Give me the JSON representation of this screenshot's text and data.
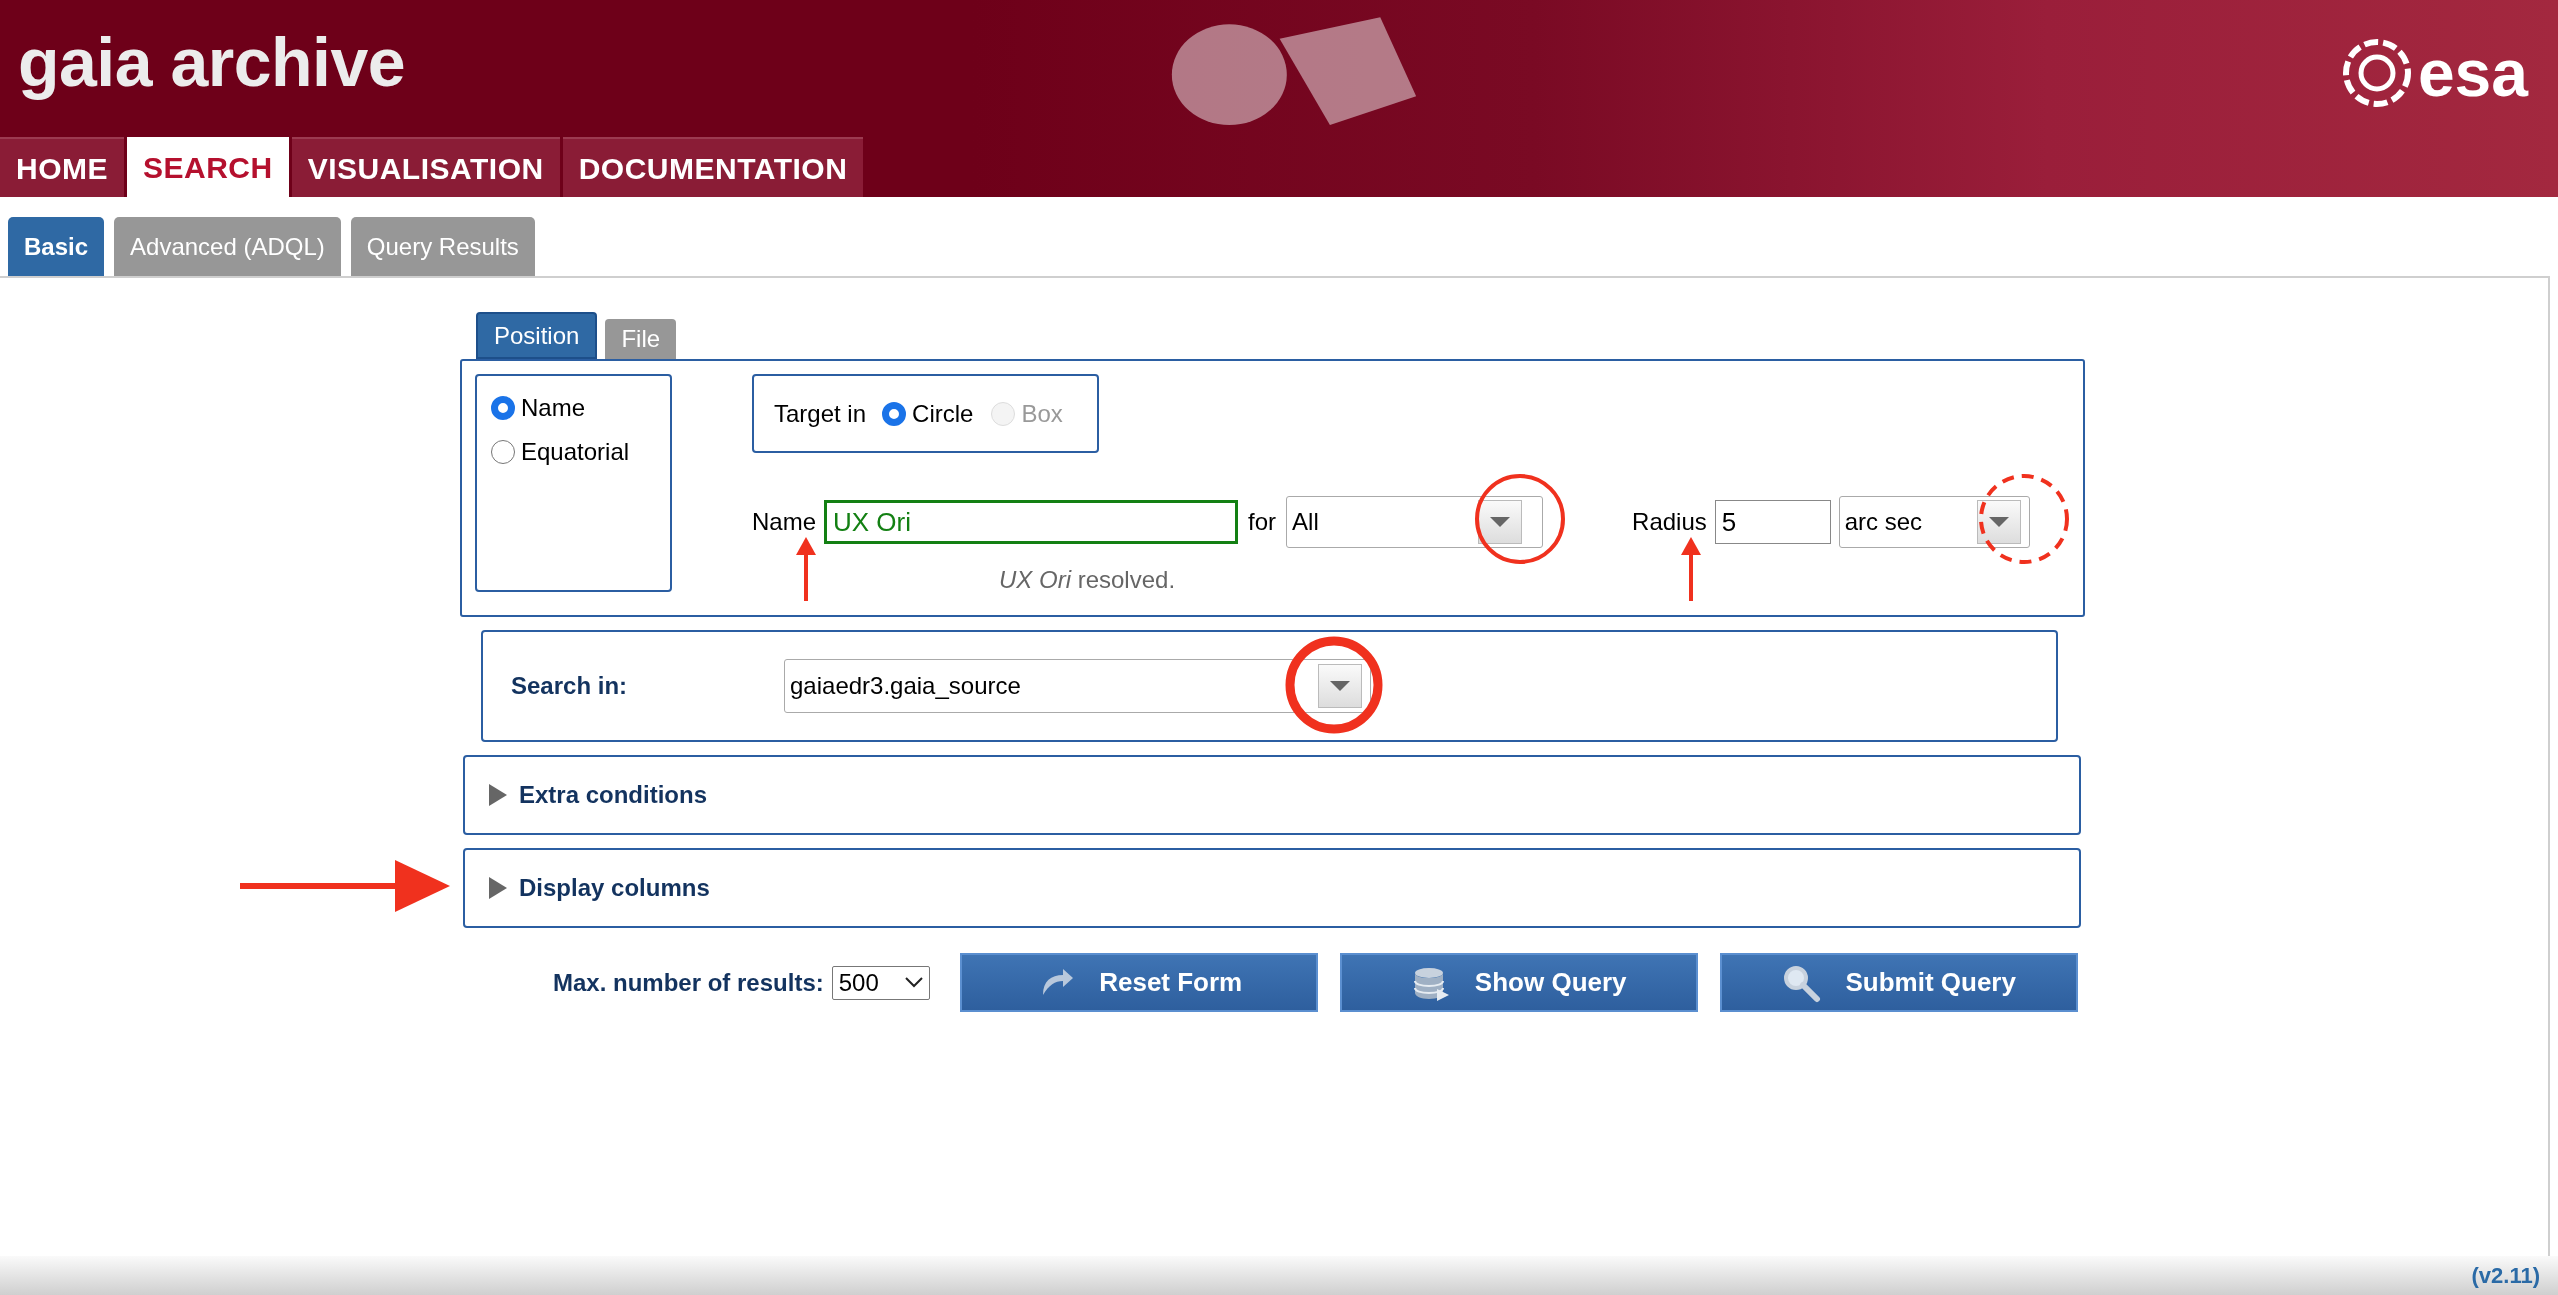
{
  "header": {
    "title": "gaia archive",
    "logo_text": "esa"
  },
  "nav": [
    {
      "label": "HOME",
      "selected": false
    },
    {
      "label": "SEARCH",
      "selected": true
    },
    {
      "label": "VISUALISATION",
      "selected": false
    },
    {
      "label": "DOCUMENTATION",
      "selected": false
    }
  ],
  "subtabs": [
    {
      "label": "Basic",
      "selected": true
    },
    {
      "label": "Advanced (ADQL)",
      "selected": false
    },
    {
      "label": "Query Results",
      "selected": false
    }
  ],
  "position_tabs": [
    {
      "label": "Position",
      "selected": true
    },
    {
      "label": "File",
      "selected": false
    }
  ],
  "target_type": [
    {
      "label": "Name",
      "selected": true
    },
    {
      "label": "Equatorial",
      "selected": false
    }
  ],
  "target_in": {
    "label": "Target in",
    "options": [
      {
        "label": "Circle",
        "selected": true,
        "disabled": false
      },
      {
        "label": "Box",
        "selected": false,
        "disabled": true
      }
    ]
  },
  "name_field": {
    "label": "Name",
    "value": "UX Ori",
    "status": "*UX Ori* resolved."
  },
  "for_field": {
    "label": "for",
    "value": "All"
  },
  "radius": {
    "label": "Radius",
    "value": "5",
    "unit": "arc sec"
  },
  "search_in": {
    "label": "Search in:",
    "value": "gaiaedr3.gaia_source"
  },
  "sections": [
    {
      "label": "Extra conditions",
      "expanded": false
    },
    {
      "label": "Display columns",
      "expanded": false
    }
  ],
  "max_results": {
    "label": "Max. number of results:",
    "value": "500"
  },
  "buttons": [
    {
      "label": "Reset Form",
      "kind": "reset"
    },
    {
      "label": "Show Query",
      "kind": "show"
    },
    {
      "label": "Submit Query",
      "kind": "submit"
    }
  ],
  "version": "(v2.11)"
}
